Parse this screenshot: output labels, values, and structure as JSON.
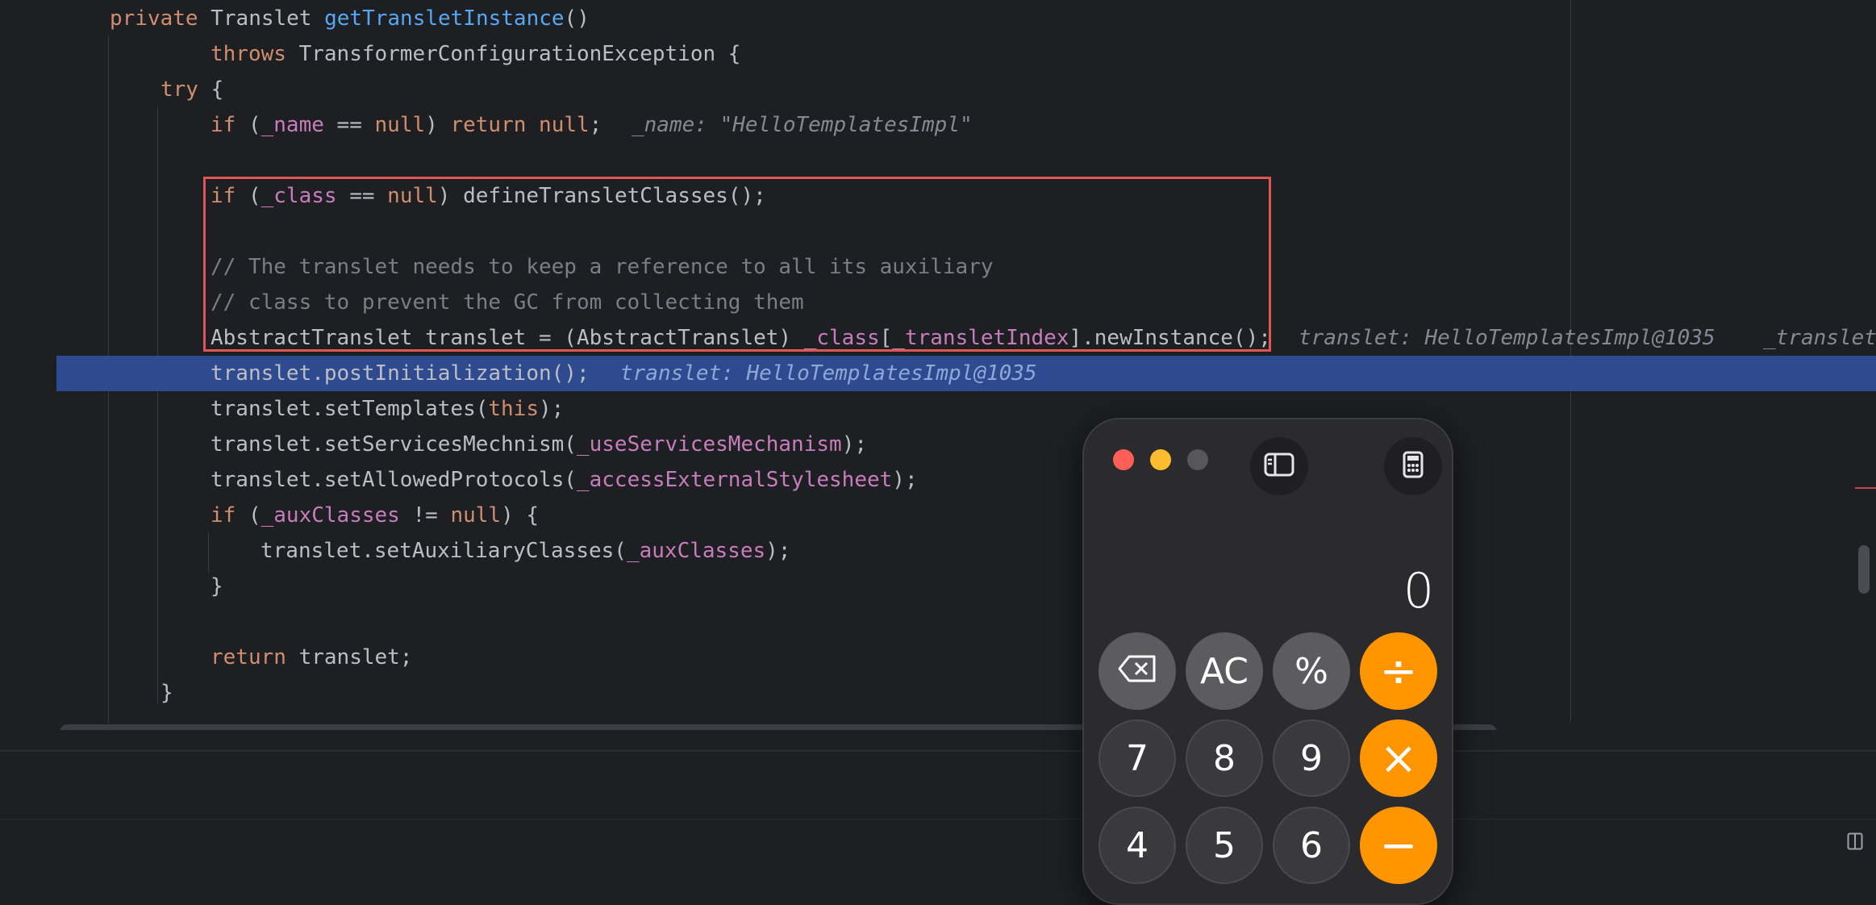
{
  "code": {
    "l1": {
      "kw": "private",
      "type": " Translet ",
      "fn": "getTransletInstance",
      "rest": "()"
    },
    "l2": {
      "kw": "throws",
      "rest": " TransformerConfigurationException {"
    },
    "l3": {
      "kw": "try",
      "rest": " {"
    },
    "l4": {
      "kw1": "if",
      "p1": " (",
      "field": "_name",
      "p2": " == ",
      "kw2": "null",
      "p3": ") ",
      "kw3": "return",
      "p4": " ",
      "kw4": "null",
      "p5": ";",
      "hint": "_name: \"HelloTemplatesImpl\""
    },
    "l6": {
      "kw1": "if",
      "p1": " (",
      "field": "_class",
      "p2": " == ",
      "kw2": "null",
      "p3": ") defineTransletClasses();"
    },
    "l8": {
      "comment": "// The translet needs to keep a reference to all its auxiliary"
    },
    "l9": {
      "comment": "// class to prevent the GC from collecting them"
    },
    "l10": {
      "p1": "AbstractTranslet translet = (AbstractTranslet) ",
      "f1": "_class",
      "p2": "[",
      "f2": "_transletIndex",
      "p3": "].newInstance();",
      "hint1": "translet: HelloTemplatesImpl@1035",
      "hint2": "_translet"
    },
    "l11": {
      "text": "translet.postInitialization();",
      "hint": "translet: HelloTemplatesImpl@1035"
    },
    "l12": {
      "p1": "translet.setTemplates(",
      "kw": "this",
      "p2": ");"
    },
    "l13": {
      "p1": "translet.setServicesMechnism(",
      "field": "_useServicesMechanism",
      "p2": ");"
    },
    "l14": {
      "p1": "translet.setAllowedProtocols(",
      "field": "_accessExternalStylesheet",
      "p2": ");"
    },
    "l15": {
      "kw1": "if",
      "p1": " (",
      "field": "_auxClasses",
      "p2": " != ",
      "kw2": "null",
      "p3": ") {"
    },
    "l16": {
      "p1": "translet.setAuxiliaryClasses(",
      "field": "_auxClasses",
      "p2": ");"
    },
    "l17": {
      "text": "}"
    },
    "l19": {
      "kw": "return",
      "rest": " translet;"
    },
    "l20": {
      "text": "}"
    }
  },
  "calculator": {
    "display": "0",
    "keys": {
      "backspace": "⌫",
      "ac": "AC",
      "percent": "%",
      "divide": "÷",
      "seven": "7",
      "eight": "8",
      "nine": "9",
      "multiply": "×",
      "four": "4",
      "five": "5",
      "six": "6",
      "minus": "−"
    }
  },
  "colors": {
    "editor_bg": "#1e1f22",
    "keyword": "#cf8e6d",
    "function": "#56a8f5",
    "field": "#c77dbb",
    "execution_line": "#2e4b8f",
    "highlight_border": "#e05555",
    "calc_operator": "#ff9500"
  },
  "icons": [
    "sidebar-toggle-icon",
    "calculator-icon",
    "backspace-icon",
    "layout-icon"
  ]
}
